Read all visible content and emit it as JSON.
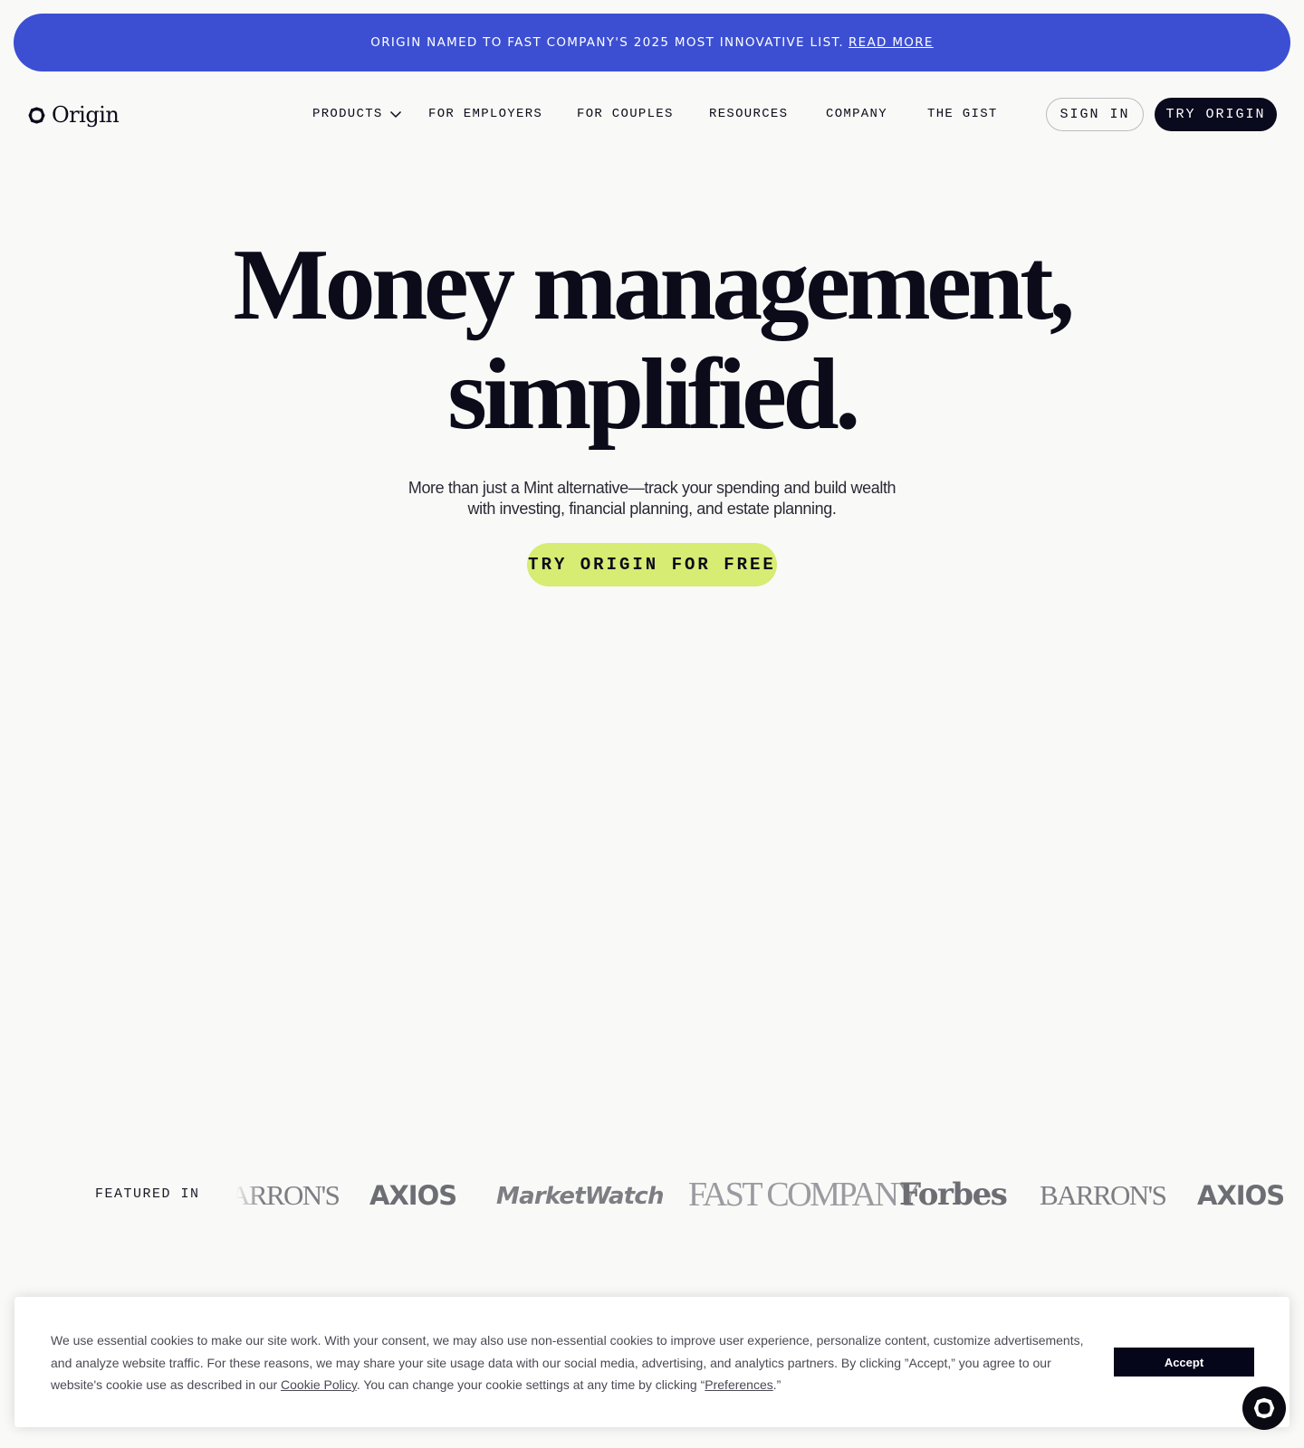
{
  "banner": {
    "text": "ORIGIN NAMED TO FAST COMPANY'S 2025 MOST INNOVATIVE LIST.",
    "link": "READ MORE",
    "color": "#3c4fd2"
  },
  "nav": {
    "brand": "Origin",
    "links": [
      "PRODUCTS",
      "FOR EMPLOYERS",
      "FOR COUPLES",
      "RESOURCES",
      "COMPANY",
      "THE GIST"
    ],
    "sign_in": "SIGN IN",
    "try_origin": "TRY ORIGIN"
  },
  "hero": {
    "title_line1": "Money management,",
    "title_line2": "simplified.",
    "subtitle_line1": "More than just a Mint alternative—track your spending and build wealth",
    "subtitle_line2": "with investing, financial planning, and estate planning.",
    "cta": "TRY ORIGIN FOR FREE",
    "cta_color": "#d6ec73"
  },
  "featured": {
    "label": "FEATURED IN",
    "publications": [
      "BARRON'S",
      "AXIOS",
      "MarketWatch",
      "FAST COMPANY",
      "Forbes",
      "BARRON'S",
      "AXIOS"
    ]
  },
  "cookie": {
    "text_before": "We use essential cookies to make our site work. With your consent, we may also use non-essential cookies to improve user experience, personalize content, customize advertisements, and analyze website traffic. For these reasons, we may share your site usage data with our social media, advertising, and analytics partners. By clicking ”Accept,” you agree to our website's cookie use as described in our ",
    "policy_link": "Cookie Policy",
    "text_middle": ". You can change your cookie settings at any time by clicking “",
    "preferences_link": "Preferences",
    "text_after": ".”",
    "accept": "Accept"
  },
  "icons": {
    "brand_logo": "origin-logo-icon",
    "dropdown": "chevron-down-icon",
    "chat": "chat-launcher-icon"
  }
}
